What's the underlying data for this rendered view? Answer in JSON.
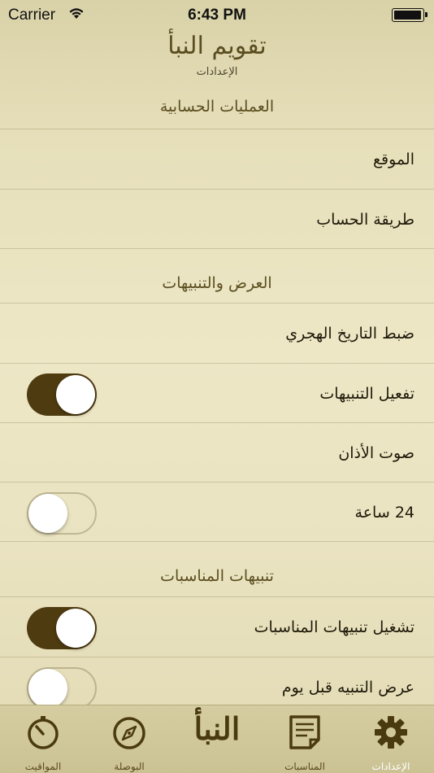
{
  "status_bar": {
    "carrier": "Carrier",
    "time": "6:43 PM"
  },
  "header": {
    "title": "تقويم النبأ",
    "subtitle": "الإعدادات"
  },
  "sections": [
    {
      "title": "العمليات الحسابية",
      "rows": [
        {
          "label": "الموقع"
        },
        {
          "label": "طريقة الحساب"
        }
      ]
    },
    {
      "title": "العرض والتنبيهات",
      "rows": [
        {
          "label": "ضبط التاريخ الهجري"
        },
        {
          "label": "تفعيل التنبيهات",
          "toggle": "on"
        },
        {
          "label": "صوت الأذان"
        },
        {
          "label": "24 ساعة",
          "toggle": "off"
        }
      ]
    },
    {
      "title": "تنبيهات المناسبات",
      "rows": [
        {
          "label": "تشغيل تنبيهات المناسبات",
          "toggle": "on"
        },
        {
          "label": "عرض التنبيه قبل يوم",
          "toggle": "off"
        }
      ]
    }
  ],
  "tab_bar": {
    "tabs": [
      {
        "label": "المواقيت",
        "icon": "stopwatch-icon"
      },
      {
        "label": "البوصلة",
        "icon": "compass-icon"
      },
      {
        "label": "النبأ",
        "icon": "app-logo"
      },
      {
        "label": "المناسبات",
        "icon": "notes-icon"
      },
      {
        "label": "الإعدادات",
        "icon": "gear-icon",
        "active": true
      }
    ]
  },
  "colors": {
    "accent": "#4f3b10",
    "background": "#ede7c6",
    "tab_bar": "#cfc79a"
  }
}
